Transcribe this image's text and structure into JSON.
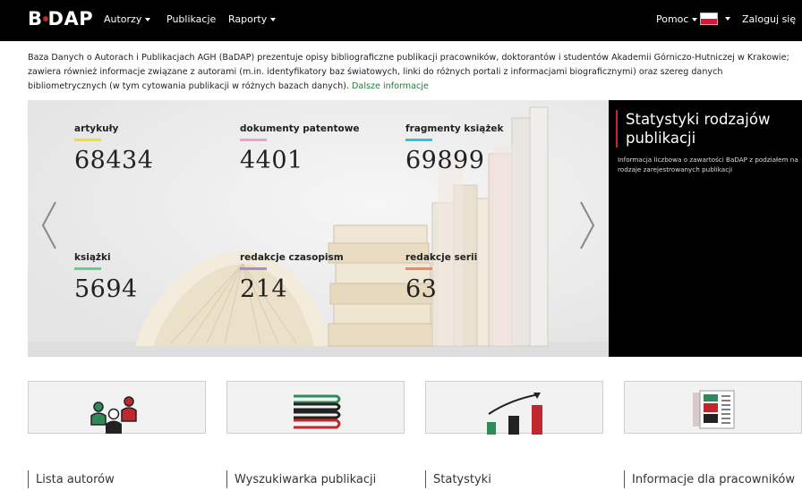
{
  "navbar": {
    "brand": "BaDAP",
    "brand_left": "B",
    "brand_right": "DAP",
    "menu": [
      {
        "label": "Autorzy",
        "has_caret": true
      },
      {
        "label": "Publikacje",
        "has_caret": false
      },
      {
        "label": "Raporty",
        "has_caret": true
      }
    ],
    "help": "Pomoc",
    "language": "Polski",
    "login": "Zaloguj się"
  },
  "intro": {
    "text": "Baza Danych o Autorach i Publikacjach AGH (BaDAP) prezentuje opisy bibliograficzne publikacji pracowników, doktorantów i studentów Akademii Górniczo-Hutniczej w Krakowie; zawiera również informacje związane z autorami (m.in. identyfikatory baz światowych, linki do różnych portali z informacjami biograficznymi) oraz szereg danych bibliometrycznych (w tym cytowania publikacji w różnych bazach danych).",
    "more_link": "Dalsze informacje"
  },
  "carousel": {
    "stats": [
      {
        "label": "artykuły",
        "value": "68434",
        "color": "#f0e020"
      },
      {
        "label": "dokumenty patentowe",
        "value": "4401",
        "color": "#f59ad6"
      },
      {
        "label": "fragmenty książek",
        "value": "69899",
        "color": "#29c5e6"
      },
      {
        "label": "książki",
        "value": "5694",
        "color": "#5fd28a"
      },
      {
        "label": "redakcje czasopism",
        "value": "214",
        "color": "#a78be0"
      },
      {
        "label": "redakcje serii",
        "value": "63",
        "color": "#f2866a"
      }
    ],
    "prev_label": "‹",
    "next_label": "›"
  },
  "side_panel": {
    "title": "Statystyki rodzajów publikacji",
    "description": "Informacja liczbowa o zawartości BaDAP z podziałem na rodzaje zarejestrowanych publikacji"
  },
  "tiles": [
    {
      "label": "Lista autorów",
      "icon": "authors-icon"
    },
    {
      "label": "Wyszukiwarka publikacji",
      "icon": "books-icon"
    },
    {
      "label": "Statystyki",
      "icon": "stats-chart-icon"
    },
    {
      "label": "Informacje dla pracowników",
      "icon": "newspaper-icon"
    }
  ],
  "colors": {
    "accent_red": "#c1272d",
    "accent_green": "#1f7a3c",
    "navbar": "#000000"
  }
}
